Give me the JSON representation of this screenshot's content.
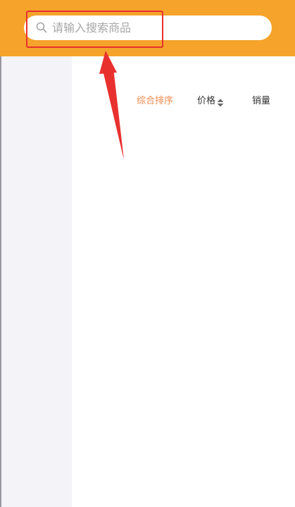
{
  "search": {
    "placeholder": "请输入搜索商品",
    "value": ""
  },
  "sort": {
    "items": [
      {
        "label": "综合排序",
        "active": true
      },
      {
        "label": "价格",
        "active": false
      },
      {
        "label": "销量",
        "active": false
      }
    ]
  },
  "colors": {
    "header": "#f5a32a",
    "active_sort": "#f08a4b",
    "sidebar": "#f4f3f8",
    "annotation": "#e8312f"
  },
  "icons": {
    "search": "search-icon",
    "sort": "sort-arrows-icon"
  }
}
